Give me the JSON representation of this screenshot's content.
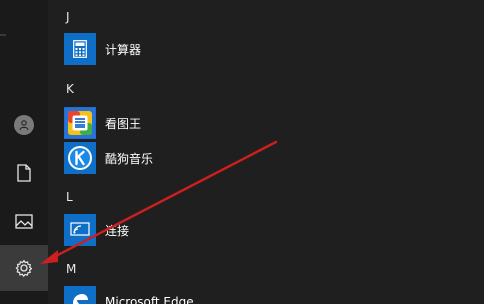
{
  "rail": {
    "items": [
      {
        "name": "user",
        "icon": "user-avatar-icon"
      },
      {
        "name": "documents",
        "icon": "document-icon"
      },
      {
        "name": "pictures",
        "icon": "picture-icon"
      },
      {
        "name": "settings",
        "icon": "gear-icon",
        "active": true
      }
    ]
  },
  "groups": [
    {
      "letter": "J",
      "apps": [
        {
          "label": "计算器",
          "icon": "calculator-icon"
        }
      ]
    },
    {
      "letter": "K",
      "apps": [
        {
          "label": "看图王",
          "icon": "image-viewer-icon"
        },
        {
          "label": "酷狗音乐",
          "icon": "kugou-icon"
        }
      ]
    },
    {
      "letter": "L",
      "apps": [
        {
          "label": "连接",
          "icon": "connect-icon"
        }
      ]
    },
    {
      "letter": "M",
      "apps": [
        {
          "label": "Microsoft Edge",
          "icon": "edge-icon"
        }
      ]
    }
  ],
  "annotation": {
    "type": "arrow",
    "color": "#cc1f1f",
    "points_to": "settings"
  },
  "colors": {
    "background": "#1f1f1f",
    "rail": "#1a1a1a",
    "accent": "#0f6fc6",
    "arrow": "#cc1f1f"
  }
}
